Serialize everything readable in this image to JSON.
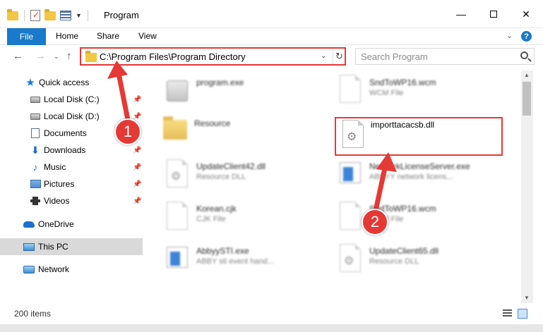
{
  "window": {
    "title": "Program",
    "minimize_glyph": "—",
    "close_glyph": "✕"
  },
  "ribbon": {
    "tabs": [
      "File",
      "Home",
      "Share",
      "View"
    ],
    "help_glyph": "?",
    "expand_glyph": "⌄"
  },
  "nav": {
    "back_glyph": "←",
    "forward_glyph": "→",
    "recent_glyph": "⌄",
    "up_glyph": "↑"
  },
  "address": {
    "path": "C:\\Program Files\\Program Directory",
    "dropdown_glyph": "⌄",
    "refresh_glyph": "↻"
  },
  "search": {
    "placeholder": "Search Program"
  },
  "sidebar": {
    "items": [
      {
        "label": "Quick access",
        "icon": "star-icon"
      },
      {
        "label": "Local Disk (C:)",
        "icon": "disk-icon",
        "pinned": true
      },
      {
        "label": "Local Disk (D:)",
        "icon": "disk-icon",
        "pinned": true
      },
      {
        "label": "Documents",
        "icon": "documents-icon",
        "pinned": true
      },
      {
        "label": "Downloads",
        "icon": "download-icon",
        "pinned": true
      },
      {
        "label": "Music",
        "icon": "music-icon",
        "pinned": true
      },
      {
        "label": "Pictures",
        "icon": "pictures-icon",
        "pinned": true
      },
      {
        "label": "Videos",
        "icon": "videos-icon",
        "pinned": true
      },
      {
        "label": "OneDrive",
        "icon": "cloud-icon"
      },
      {
        "label": "This PC",
        "icon": "computer-icon",
        "selected": true
      },
      {
        "label": "Network",
        "icon": "network-icon"
      }
    ],
    "pin_glyph": "📌"
  },
  "files": [
    {
      "name": "program.exe",
      "type": "",
      "icon": "exe-icon"
    },
    {
      "name": "SndToWP16.wcm",
      "type": "WCM File",
      "icon": "file-icon"
    },
    {
      "name": "Resource",
      "type": "",
      "icon": "folder-icon"
    },
    {
      "name": "importtacacsb.dll",
      "type": "",
      "icon": "dll-icon",
      "highlighted": true
    },
    {
      "name": "UpdateClient42.dll",
      "type": "Resource DLL",
      "icon": "dll-icon"
    },
    {
      "name": "NetworkLicenseServer.exe",
      "type": "ABBYY network licens...",
      "icon": "app-icon"
    },
    {
      "name": "Korean.cjk",
      "type": "CJK File",
      "icon": "file-icon"
    },
    {
      "name": "SndToWP16.wcm",
      "type": "WCM File",
      "icon": "file-icon"
    },
    {
      "name": "AbbyySTI.exe",
      "type": "ABBY sti event hand...",
      "icon": "app-icon"
    },
    {
      "name": "UpdateClient65.dll",
      "type": "Resource DLL",
      "icon": "dll-icon"
    }
  ],
  "status": {
    "count_text": "200 items"
  },
  "annotations": {
    "step1": "1",
    "step2": "2",
    "color": "#e53935"
  }
}
